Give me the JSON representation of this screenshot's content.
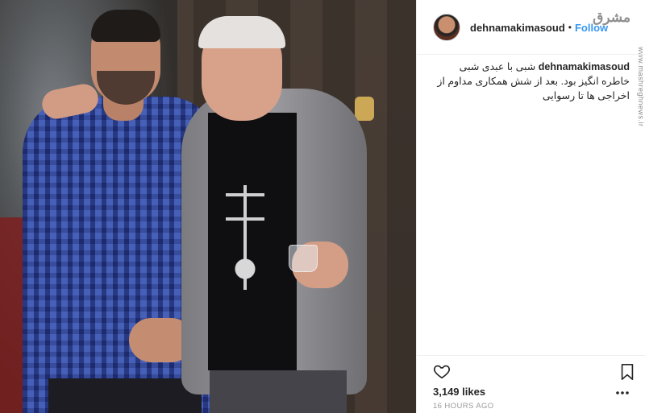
{
  "post": {
    "username": "dehnamakimasoud",
    "separator": "•",
    "follow_label": "Follow",
    "caption_text": "شبی با عبدی شبی خاطره انگیز بود. بعد از شش همکاری مداوم از اخراجی ها تا رسوایی",
    "likes": "3,149 likes",
    "timestamp": "16 HOURS AGO"
  },
  "watermark": {
    "logo": "مشرق",
    "url": "www.mashreghnews.ir"
  },
  "icons": {
    "like": "heart-icon",
    "save": "bookmark-icon",
    "more": "more-options-icon"
  },
  "colors": {
    "follow": "#3897f0",
    "text": "#262626",
    "muted": "#999999"
  }
}
